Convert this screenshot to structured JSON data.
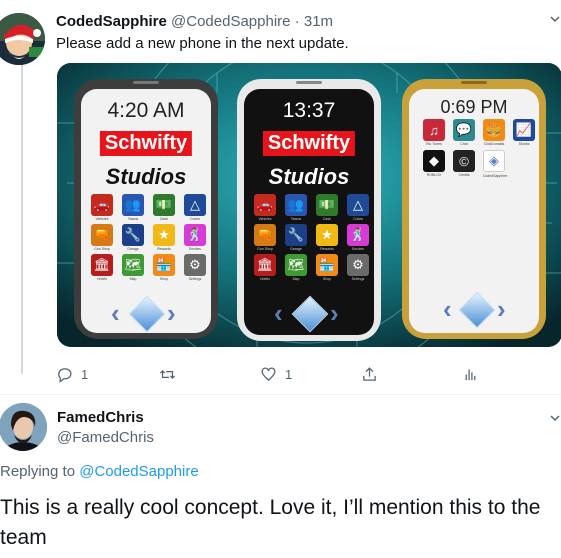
{
  "tweet1": {
    "display_name": "CodedSapphire",
    "handle": "@CodedSapphire",
    "separator": "·",
    "time": "31m",
    "text": "Please add a new phone in the next update.",
    "menu_icon": "chevron-down-icon",
    "media": {
      "phones": [
        {
          "time": "4:20 AM",
          "brand_line1": "Schwifty",
          "brand_line2": "Studios",
          "apps": [
            {
              "label": "Vehicles",
              "icon": "car-icon",
              "color": "#c62a1c"
            },
            {
              "label": "Teams",
              "icon": "people-icon",
              "color": "#2a56b0"
            },
            {
              "label": "Cash",
              "icon": "cash-icon",
              "color": "#2f7a2c"
            },
            {
              "label": "Codes",
              "icon": "triangle-icon",
              "color": "#1e4a96"
            },
            {
              "label": "Gun Shop",
              "icon": "gun-icon",
              "color": "#d67a16"
            },
            {
              "label": "Garage",
              "icon": "wrench-icon",
              "color": "#1d3f8a"
            },
            {
              "label": "Rewards",
              "icon": "star-icon",
              "color": "#f0b915"
            },
            {
              "label": "Emotes",
              "icon": "dance-icon",
              "color": "#d83ad6"
            },
            {
              "label": "Hotels",
              "icon": "building-icon",
              "color": "#b81d1d"
            },
            {
              "label": "Map",
              "icon": "map-icon",
              "color": "#3f9a33"
            },
            {
              "label": "Shop",
              "icon": "shop-icon",
              "color": "#f28b16"
            },
            {
              "label": "Settings",
              "icon": "gear-icon",
              "color": "#6a6a6a"
            }
          ]
        },
        {
          "time": "13:37",
          "brand_line1": "Schwifty",
          "brand_line2": "Studios",
          "apps": [
            {
              "label": "Vehicles",
              "icon": "car-icon",
              "color": "#c62a1c"
            },
            {
              "label": "Teams",
              "icon": "people-icon",
              "color": "#2a56b0"
            },
            {
              "label": "Cash",
              "icon": "cash-icon",
              "color": "#2f7a2c"
            },
            {
              "label": "Codes",
              "icon": "triangle-icon",
              "color": "#1e4a96"
            },
            {
              "label": "Gun Shop",
              "icon": "gun-icon",
              "color": "#d67a16"
            },
            {
              "label": "Garage",
              "icon": "wrench-icon",
              "color": "#1d3f8a"
            },
            {
              "label": "Rewards",
              "icon": "star-icon",
              "color": "#f0b915"
            },
            {
              "label": "Emotes",
              "icon": "dance-icon",
              "color": "#d83ad6"
            },
            {
              "label": "Hotels",
              "icon": "building-icon",
              "color": "#b81d1d"
            },
            {
              "label": "Map",
              "icon": "map-icon",
              "color": "#3f9a33"
            },
            {
              "label": "Shop",
              "icon": "shop-icon",
              "color": "#f28b16"
            },
            {
              "label": "Settings",
              "icon": "gear-icon",
              "color": "#6a6a6a"
            }
          ]
        },
        {
          "time": "0:69 PM",
          "apps": [
            {
              "label": "Rio Tunes",
              "icon": "music-icon",
              "color": "#c8283a"
            },
            {
              "label": "Chat",
              "icon": "chat-icon",
              "color": "#2c8a92"
            },
            {
              "label": "ClickDonalds",
              "icon": "burger-icon",
              "color": "#f28b16"
            },
            {
              "label": "Stonks",
              "icon": "chart-icon",
              "color": "#1d4a9c"
            },
            {
              "label": "ROBLOX",
              "icon": "roblox-icon",
              "color": "#111111"
            },
            {
              "label": "Credits",
              "icon": "copyright-icon",
              "color": "#222222"
            },
            {
              "label": "CodedSapphire",
              "icon": "sapphire-icon",
              "color": "#ffffff"
            }
          ]
        }
      ]
    },
    "actions": {
      "reply_count": "1",
      "retweet_count": "",
      "like_count": "1",
      "icons": [
        "reply-icon",
        "retweet-icon",
        "like-icon",
        "share-icon",
        "analytics-icon"
      ]
    }
  },
  "tweet2": {
    "display_name": "FamedChris",
    "handle": "@FamedChris",
    "replying_prefix": "Replying to",
    "replying_to": "@CodedSapphire",
    "text": "This is a really cool concept. Love it, I’ll mention this to the team",
    "menu_icon": "chevron-down-icon"
  },
  "colors": {
    "link": "#1d9bf0",
    "secondary_text": "#536471",
    "brand_red": "#e8141b"
  }
}
